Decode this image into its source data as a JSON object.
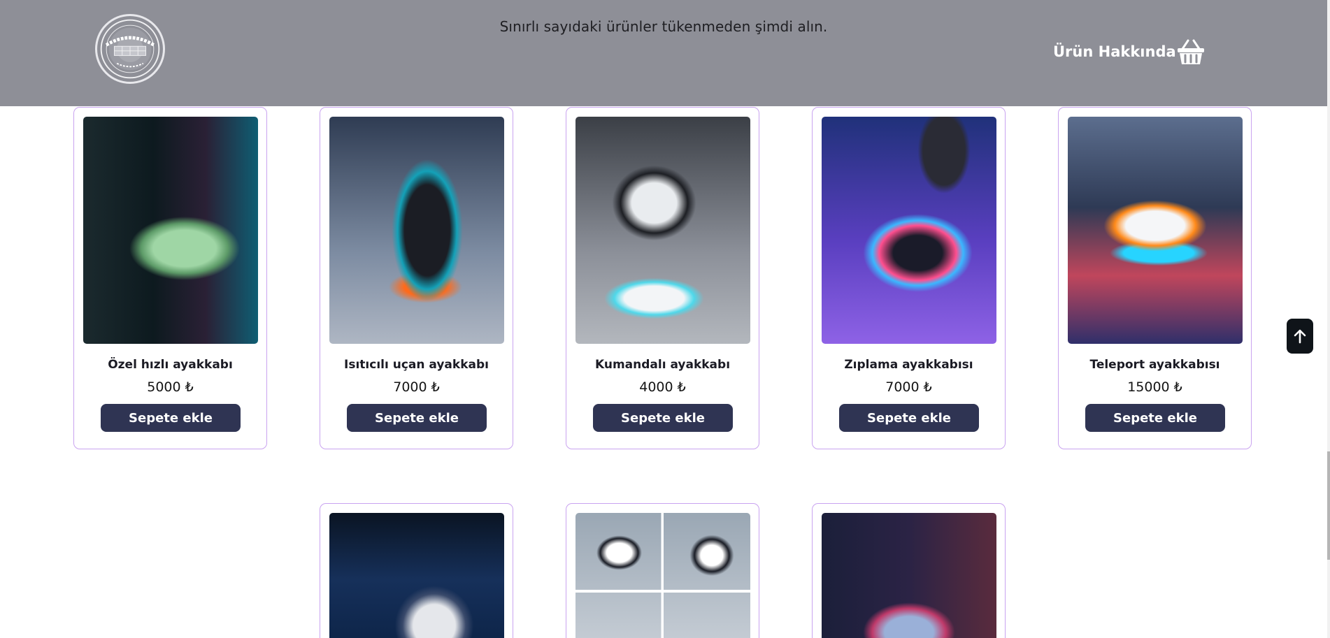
{
  "header": {
    "promo_text": "Sınırlı sayıdaki ürünler tükenmeden şimdi alın.",
    "about_label": "Ürün Hakkında",
    "logo_text": "LUMIONVISIDE",
    "logo_subtext": "OF FUTURE",
    "cart_icon": "basket-icon"
  },
  "colors": {
    "header_bg": "#8e8f97",
    "button_bg": "#2f3453",
    "card_border": "#c9a3f0"
  },
  "products": [
    {
      "name": "Özel hızlı ayakkabı",
      "price": "5000 ₺",
      "button": "Sepete ekle"
    },
    {
      "name": "Isıtıcılı uçan ayakkabı",
      "price": "7000 ₺",
      "button": "Sepete ekle"
    },
    {
      "name": "Kumandalı ayakkabı",
      "price": "4000 ₺",
      "button": "Sepete ekle"
    },
    {
      "name": "Zıplama ayakkabısı",
      "price": "7000 ₺",
      "button": "Sepete ekle"
    },
    {
      "name": "Teleport ayakkabısı",
      "price": "15000 ₺",
      "button": "Sepete ekle"
    }
  ],
  "back_to_top_icon": "arrow-up-icon"
}
